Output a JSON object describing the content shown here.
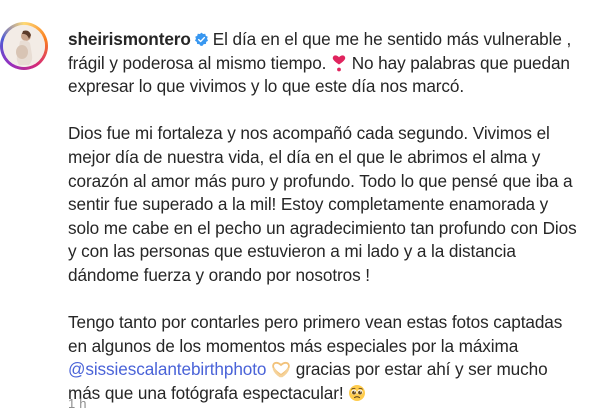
{
  "author": {
    "username": "sheirismontero",
    "verified": true,
    "avatar": "profile-photo"
  },
  "caption": {
    "paragraphs": [
      [
        "El día en el que me he sentido más vulnerable ,",
        "frágil y poderosa al mismo tiempo.",
        "No hay palabras que puedan",
        "expresar lo que vivimos y lo que este día nos marcó."
      ],
      [
        "Dios fue mi fortaleza y nos acompañó cada segundo. Vivimos el",
        "mejor día de nuestra vida, el día en el que le abrimos el alma y",
        "corazón al amor más puro y profundo. Todo lo que pensé que iba a",
        "sentir fue superado a la mil! Estoy completamente enamorada y",
        "solo me cabe en el pecho un agradecimiento tan profundo con Dios",
        "y con las personas que estuvieron a mi lado y a la distancia",
        "dándome fuerza y orando por nosotros !"
      ],
      [
        "Tengo tanto por contarles pero primero vean estas fotos captadas",
        "en algunos de los momentos más especiales por la máxima",
        "@sissiescalantebirthphoto",
        "gracias por estar ahí y ser mucho",
        "más que una fotógrafa espectacular!"
      ]
    ]
  },
  "emojis": {
    "heart": "heart-exclamation-icon",
    "hands": "heart-hands-icon",
    "pleading": "pleading-face-icon"
  },
  "timestamp": "1 h",
  "colors": {
    "text": "#262626",
    "mention": "#4a63d8",
    "verified": "#3897f0",
    "heart": "#e0245e",
    "timestamp": "#8e8e8e"
  }
}
